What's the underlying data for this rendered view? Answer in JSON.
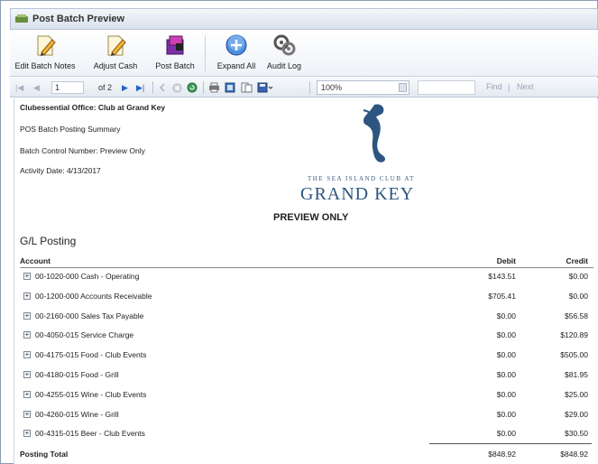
{
  "window": {
    "title": "Post Batch Preview"
  },
  "ribbon": {
    "buttons": [
      {
        "label": "Edit Batch Notes",
        "icon": "edit-notes-icon"
      },
      {
        "label": "Adjust Cash",
        "icon": "adjust-cash-icon"
      },
      {
        "label": "Post Batch",
        "icon": "post-batch-icon"
      },
      {
        "label": "Expand All",
        "icon": "expand-all-icon"
      },
      {
        "label": "Audit Log",
        "icon": "audit-log-icon"
      }
    ]
  },
  "toolbar": {
    "first_page": "|◀",
    "prev_page": "◀",
    "current_page": "1",
    "of_pages": "of 2",
    "next_page": "▶",
    "last_page": "▶|",
    "zoom": "100%",
    "find": "Find",
    "separator": "|",
    "next": "Next"
  },
  "report": {
    "office": "Clubessential Office: Club at Grand Key",
    "summary_title": "POS Batch Posting Summary",
    "batch_control": "Batch Control Number: Preview Only",
    "activity_date": "Activity Date: 4/13/2017",
    "logo_small": "THE SEA ISLAND CLUB AT",
    "logo_big": "GRAND KEY",
    "preview_label": "PREVIEW ONLY",
    "section_title": "G/L Posting",
    "columns": {
      "account": "Account",
      "debit": "Debit",
      "credit": "Credit"
    },
    "rows": [
      {
        "account": "00-1020-000 Cash - Operating",
        "debit": "$143.51",
        "credit": "$0.00"
      },
      {
        "account": "00-1200-000 Accounts Receivable",
        "debit": "$705.41",
        "credit": "$0.00"
      },
      {
        "account": "00-2160-000 Sales Tax Payable",
        "debit": "$0.00",
        "credit": "$56.58"
      },
      {
        "account": "00-4050-015 Service Charge",
        "debit": "$0.00",
        "credit": "$120.89"
      },
      {
        "account": "00-4175-015 Food - Club Events",
        "debit": "$0.00",
        "credit": "$505.00"
      },
      {
        "account": "00-4180-015 Food - Grill",
        "debit": "$0.00",
        "credit": "$81.95"
      },
      {
        "account": "00-4255-015 Wine - Club Events",
        "debit": "$0.00",
        "credit": "$25.00"
      },
      {
        "account": "00-4260-015 Wine - Grill",
        "debit": "$0.00",
        "credit": "$29.00"
      },
      {
        "account": "00-4315-015 Beer - Club Events",
        "debit": "$0.00",
        "credit": "$30.50"
      }
    ],
    "total": {
      "label": "Posting Total",
      "debit": "$848.92",
      "credit": "$848.92"
    }
  },
  "colors": {
    "accent": "#2d557f",
    "toolbar_blue": "#1f63c8"
  }
}
